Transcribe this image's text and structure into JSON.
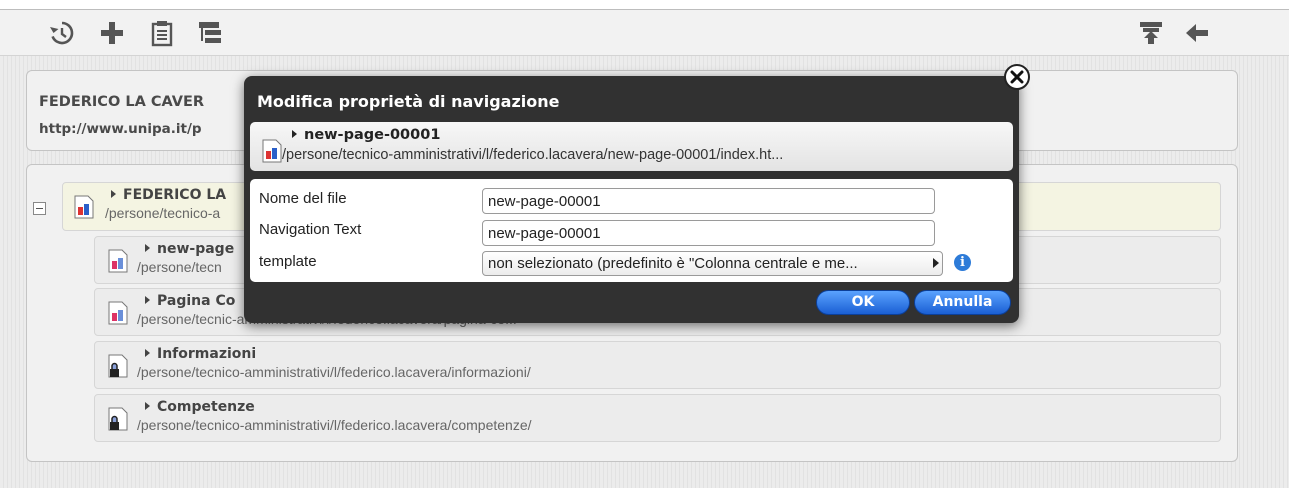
{
  "toolbar": {
    "icons": [
      "history-icon",
      "add-icon",
      "clipboard-icon",
      "tree-structure-icon",
      "move-up-icon",
      "back-arrow-icon"
    ]
  },
  "info": {
    "name": "FEDERICO LA CAVER",
    "url": "http://www.unipa.it/p"
  },
  "tree": {
    "root": {
      "title": "FEDERICO LA",
      "path": "/persone/tecnico-a"
    },
    "children": [
      {
        "title": "new-page",
        "path": "/persone/tecn",
        "locked": false
      },
      {
        "title": "Pagina Co",
        "path": "/persone/tecnic",
        "path_tail": "-amministrativi/l/federico.lacavera/pagina-co...",
        "locked": false
      },
      {
        "title": "Informazioni",
        "path": "/persone/tecnico-amministrativi/l/federico.lacavera/informazioni/",
        "locked": true
      },
      {
        "title": "Competenze",
        "path": "/persone/tecnico-amministrativi/l/federico.lacavera/competenze/",
        "locked": true
      }
    ]
  },
  "modal": {
    "title": "Modifica proprietà di navigazione",
    "page_title": "new-page-00001",
    "page_path": "/persone/tecnico-amministrativi/l/federico.lacavera/new-page-00001/index.ht...",
    "fields": {
      "filename_label": "Nome del file",
      "filename_value": "new-page-00001",
      "navtext_label": "Navigation Text",
      "navtext_value": "new-page-00001",
      "template_label": "template",
      "template_value": "non selezionato (predefinito è \"Colonna centrale e me..."
    },
    "ok_label": "OK",
    "cancel_label": "Annulla"
  },
  "colors": {
    "button_blue": "#1a5fd3",
    "modal_bg": "#313131",
    "info_blue": "#2d7bd8"
  }
}
